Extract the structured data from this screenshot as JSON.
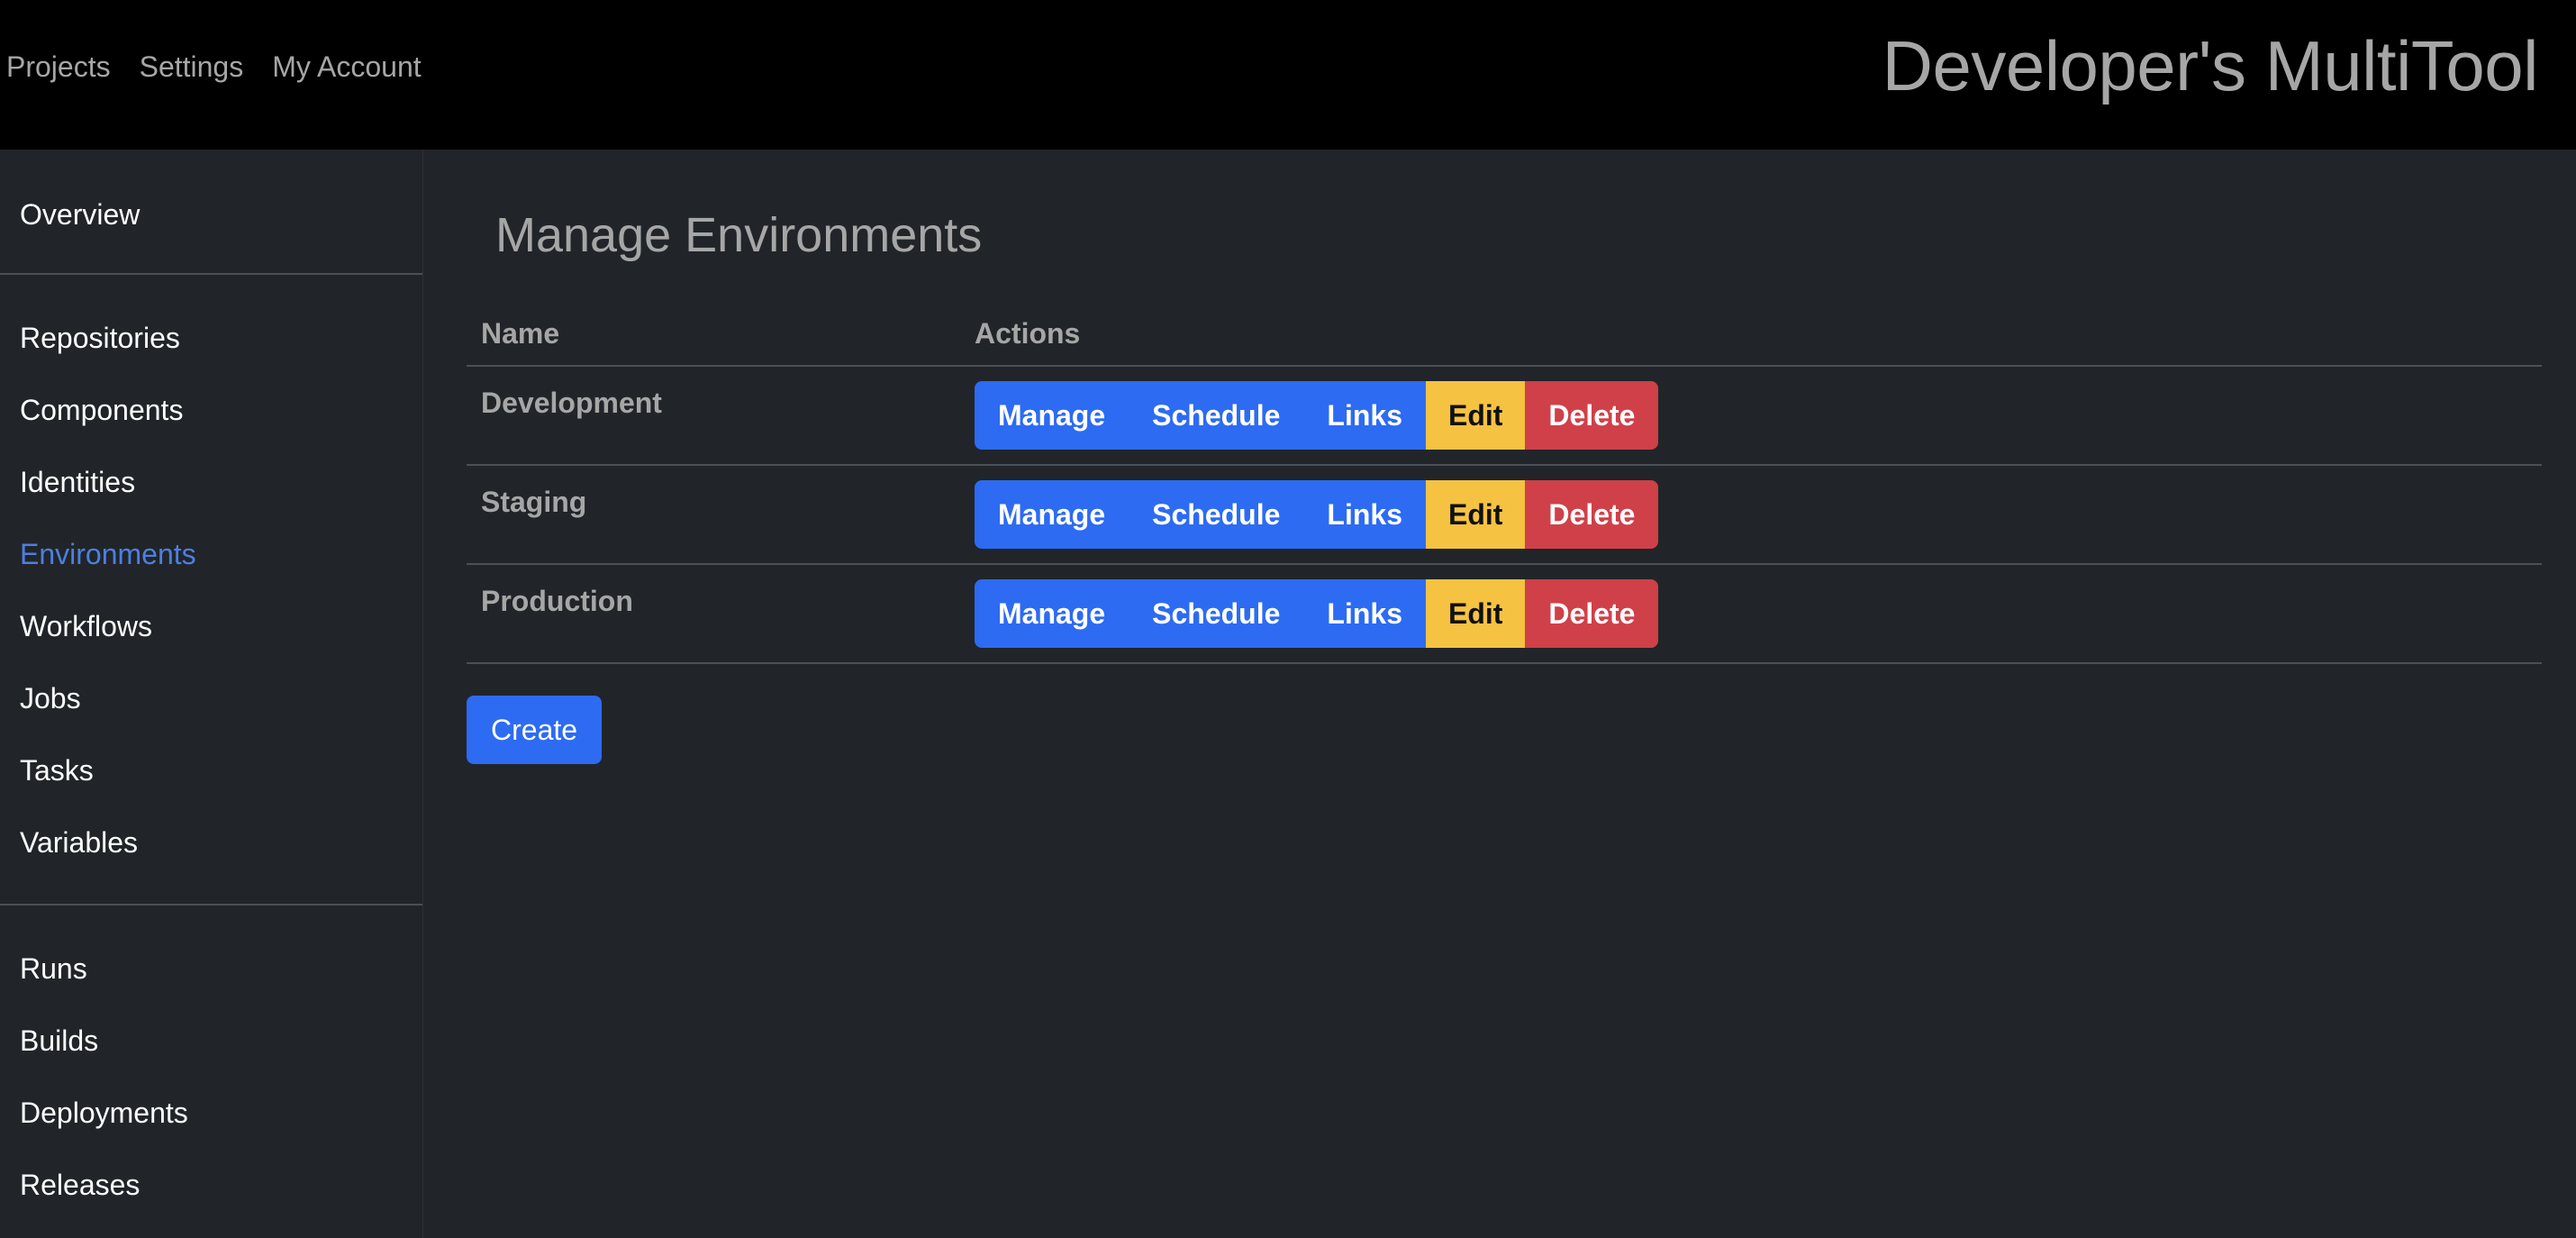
{
  "topnav": {
    "items": [
      "Projects",
      "Settings",
      "My Account"
    ]
  },
  "brand": "Developer's MultiTool",
  "sidebar": {
    "group1": [
      "Overview"
    ],
    "group2": [
      "Repositories",
      "Components",
      "Identities",
      "Environments",
      "Workflows",
      "Jobs",
      "Tasks",
      "Variables"
    ],
    "group3": [
      "Runs",
      "Builds",
      "Deployments",
      "Releases"
    ],
    "active": "Environments"
  },
  "main": {
    "title": "Manage Environments",
    "columns": {
      "name": "Name",
      "actions": "Actions"
    },
    "rows": [
      {
        "name": "Development"
      },
      {
        "name": "Staging"
      },
      {
        "name": "Production"
      }
    ],
    "actions": {
      "manage": "Manage",
      "schedule": "Schedule",
      "links": "Links",
      "edit": "Edit",
      "delete": "Delete"
    },
    "create_label": "Create"
  },
  "colors": {
    "primary": "#2d6bf2",
    "warning": "#f5c242",
    "danger": "#d04049",
    "active_link": "#4d7fe0"
  }
}
